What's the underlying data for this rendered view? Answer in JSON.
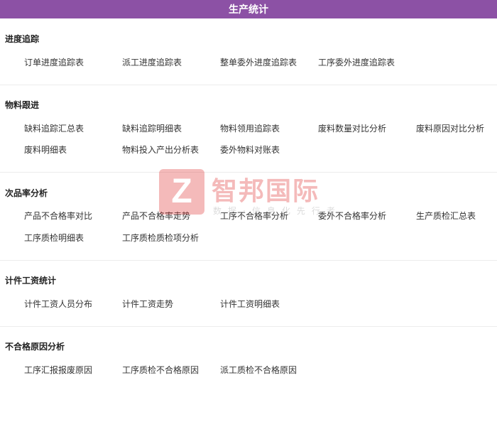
{
  "header": {
    "title": "生产统计"
  },
  "sections": [
    {
      "title": "进度追踪",
      "items": [
        "订单进度追踪表",
        "派工进度追踪表",
        "整单委外进度追踪表",
        "工序委外进度追踪表"
      ]
    },
    {
      "title": "物料跟进",
      "items": [
        "缺料追踪汇总表",
        "缺料追踪明细表",
        "物料领用追踪表",
        "废料数量对比分析",
        "废料原因对比分析",
        "废料明细表",
        "物料投入产出分析表",
        "委外物料对账表"
      ]
    },
    {
      "title": "次品率分析",
      "items": [
        "产品不合格率对比",
        "产品不合格率走势",
        "工序不合格率分析",
        "委外不合格率分析",
        "生产质检汇总表",
        "工序质检明细表",
        "工序质检质检项分析"
      ]
    },
    {
      "title": "计件工资统计",
      "items": [
        "计件工资人员分布",
        "计件工资走势",
        "计件工资明细表"
      ]
    },
    {
      "title": "不合格原因分析",
      "items": [
        "工序汇报报废原因",
        "工序质检不合格原因",
        "派工质检不合格原因"
      ]
    }
  ],
  "watermark": {
    "logo_letter": "Z",
    "name": "智邦国际",
    "slogan": "数据·信息化先行者"
  },
  "colors": {
    "header_bg": "#8c51a5",
    "watermark": "#e23b3b"
  }
}
